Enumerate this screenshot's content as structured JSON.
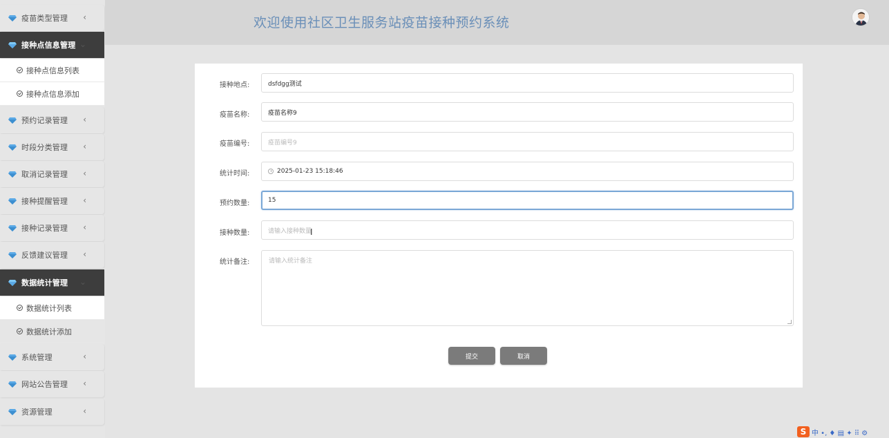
{
  "header": {
    "title": "欢迎使用社区卫生服务站疫苗接种预约系统"
  },
  "sidebar": {
    "groups": [
      {
        "label": "疫苗类型管理",
        "active": false
      },
      {
        "label": "接种点信息管理",
        "active": true,
        "items": [
          "接种点信息列表",
          "接种点信息添加"
        ]
      },
      {
        "label": "预约记录管理",
        "active": false
      },
      {
        "label": "时段分类管理",
        "active": false
      },
      {
        "label": "取消记录管理",
        "active": false
      },
      {
        "label": "接种提醒管理",
        "active": false
      },
      {
        "label": "接种记录管理",
        "active": false
      },
      {
        "label": "反馈建议管理",
        "active": false
      },
      {
        "label": "数据统计管理",
        "active": true,
        "items": [
          "数据统计列表",
          "数据统计添加"
        ]
      },
      {
        "label": "系统管理",
        "active": false
      },
      {
        "label": "网站公告管理",
        "active": false
      },
      {
        "label": "资源管理",
        "active": false
      }
    ]
  },
  "form": {
    "location_label": "接种地点:",
    "location_value": "dsfdgg测试",
    "vaccine_name_label": "疫苗名称:",
    "vaccine_name_value": "疫苗名称9",
    "vaccine_code_label": "疫苗编号:",
    "vaccine_code_value": "疫苗编号9",
    "stat_time_label": "统计时间:",
    "stat_time_value": "2025-01-23 15:18:46",
    "booking_count_label": "预约数量:",
    "booking_count_value": "15",
    "vaccination_count_label": "接种数量:",
    "vaccination_count_placeholder": "请输入接种数量",
    "remark_label": "统计备注:",
    "remark_placeholder": "请输入统计备注",
    "submit_label": "提交",
    "cancel_label": "取消"
  },
  "ime": {
    "logo": "S",
    "text": "中 •, ♦ ▤ ✦ ⠿ ⚙"
  },
  "colors": {
    "accent": "#6a8fb8",
    "active_menu": "#3d3d3d",
    "gem": "#5aa9e6",
    "button": "#7b7b7b"
  }
}
